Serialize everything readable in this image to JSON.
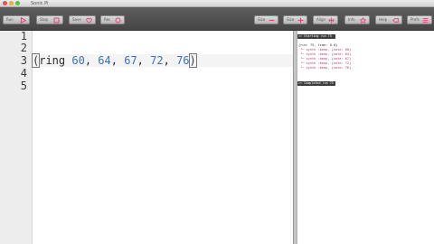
{
  "window": {
    "title": "Sonic Pi"
  },
  "toolbar": {
    "run_label": "Run",
    "stop_label": "Stop",
    "save_label": "Save",
    "rec_label": "Rec",
    "size_down_label": "Size",
    "size_up_label": "Size",
    "align_label": "Align",
    "info_label": "Info",
    "help_label": "Help",
    "prefs_label": "Prefs"
  },
  "editor": {
    "line_numbers": [
      "1",
      "2",
      "3",
      "4",
      "5"
    ],
    "code": {
      "open": "(",
      "fn": "ring",
      "nums": [
        "60",
        "64",
        "67",
        "72",
        "76"
      ],
      "comma": ",",
      "close": ")"
    }
  },
  "log": {
    "start_header": "=> Starting run 75",
    "run_line": "{run: 75, time: 0.0}",
    "entries": [
      "└─ synth :beep, {note: 60}",
      "└─ synth :beep, {note: 64}",
      "└─ synth :beep, {note: 67}",
      "└─ synth :beep, {note: 72}",
      "└─ synth :beep, {note: 76}"
    ],
    "end_header": "=> Completed run 75"
  }
}
